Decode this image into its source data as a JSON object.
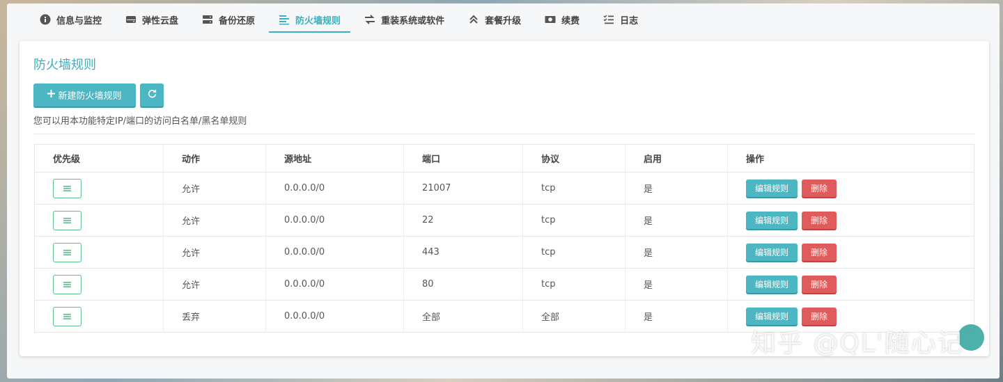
{
  "tabs": [
    {
      "label": "信息与监控",
      "icon": "info-icon"
    },
    {
      "label": "弹性云盘",
      "icon": "disk-icon"
    },
    {
      "label": "备份还原",
      "icon": "server-icon"
    },
    {
      "label": "防火墙规则",
      "icon": "list-icon",
      "active": true
    },
    {
      "label": "重装系统或软件",
      "icon": "swap-icon"
    },
    {
      "label": "套餐升级",
      "icon": "chevrons-up-icon"
    },
    {
      "label": "续费",
      "icon": "money-icon"
    },
    {
      "label": "日志",
      "icon": "checklist-icon"
    }
  ],
  "panel": {
    "title": "防火墙规则",
    "new_rule_label": "新建防火墙规则",
    "hint": "您可以用本功能特定IP/端口的访问白名单/黑名单规则"
  },
  "table": {
    "headers": [
      "优先级",
      "动作",
      "源地址",
      "端口",
      "协议",
      "启用",
      "操作"
    ],
    "rows": [
      {
        "action": "允许",
        "source": "0.0.0.0/0",
        "port": "21007",
        "protocol": "tcp",
        "enabled": "是"
      },
      {
        "action": "允许",
        "source": "0.0.0.0/0",
        "port": "22",
        "protocol": "tcp",
        "enabled": "是"
      },
      {
        "action": "允许",
        "source": "0.0.0.0/0",
        "port": "443",
        "protocol": "tcp",
        "enabled": "是"
      },
      {
        "action": "允许",
        "source": "0.0.0.0/0",
        "port": "80",
        "protocol": "tcp",
        "enabled": "是"
      },
      {
        "action": "丢弃",
        "source": "0.0.0.0/0",
        "port": "全部",
        "protocol": "全部",
        "enabled": "是"
      }
    ],
    "edit_label": "编辑规则",
    "delete_label": "删除"
  },
  "watermark": "知乎 @QL'随心记",
  "colors": {
    "accent": "#3bafbf",
    "danger": "#e05b5b",
    "drag_border": "#5cbd8a"
  }
}
